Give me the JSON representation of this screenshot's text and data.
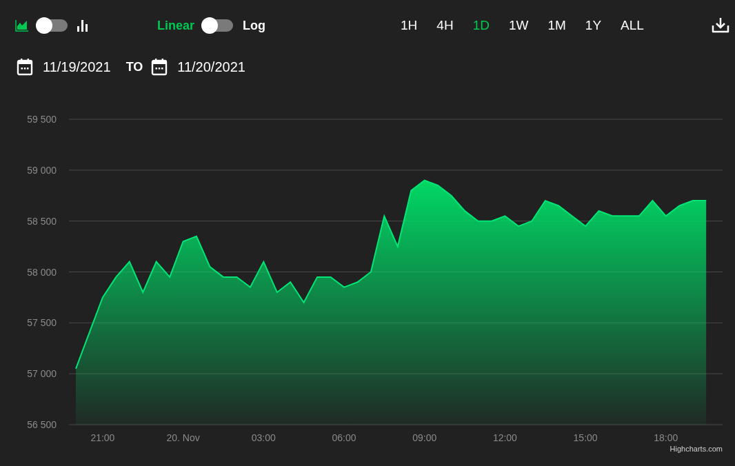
{
  "chart_type_toggle": {
    "on": false
  },
  "scale_toggle": {
    "left_label": "Linear",
    "right_label": "Log",
    "on": false
  },
  "ranges": [
    {
      "label": "1H",
      "selected": false
    },
    {
      "label": "4H",
      "selected": false
    },
    {
      "label": "1D",
      "selected": true
    },
    {
      "label": "1W",
      "selected": false
    },
    {
      "label": "1M",
      "selected": false
    },
    {
      "label": "1Y",
      "selected": false
    },
    {
      "label": "ALL",
      "selected": false
    }
  ],
  "date_range": {
    "from": "11/19/2021",
    "separator": "TO",
    "to": "11/20/2021"
  },
  "chart": {
    "credit": "Highcharts.com",
    "chart_data": {
      "type": "area",
      "categories": [
        null,
        null,
        "21:00",
        null,
        null,
        null,
        null,
        null,
        "20. Nov",
        null,
        null,
        null,
        null,
        null,
        "03:00",
        null,
        null,
        null,
        null,
        null,
        "06:00",
        null,
        null,
        null,
        null,
        null,
        "09:00",
        null,
        null,
        null,
        null,
        null,
        "12:00",
        null,
        null,
        null,
        null,
        null,
        "15:00",
        null,
        null,
        null,
        null,
        null,
        "18:00",
        null,
        null,
        null
      ],
      "series": [
        {
          "color": "#00e676",
          "values": [
            57050,
            57400,
            57750,
            57950,
            58100,
            57800,
            58100,
            57950,
            58300,
            58350,
            58050,
            57950,
            57950,
            57850,
            58100,
            57800,
            57900,
            57700,
            57950,
            57950,
            57850,
            57900,
            58000,
            58550,
            58250,
            58800,
            58900,
            58850,
            58750,
            58600,
            58500,
            58500,
            58550,
            58450,
            58500,
            58700,
            58650,
            58550,
            58450,
            58600,
            58550,
            58550,
            58550,
            58700,
            58550,
            58650,
            58700,
            58700
          ]
        }
      ],
      "ylim": [
        56500,
        59500
      ],
      "grid": true,
      "yticks": [
        {
          "value": 56500,
          "label": "56 500"
        },
        {
          "value": 57000,
          "label": "57 000"
        },
        {
          "value": 57500,
          "label": "57 500"
        },
        {
          "value": 58000,
          "label": "58 000"
        },
        {
          "value": 58500,
          "label": "58 500"
        },
        {
          "value": 59000,
          "label": "59 000"
        },
        {
          "value": 59500,
          "label": "59 500"
        }
      ]
    }
  }
}
